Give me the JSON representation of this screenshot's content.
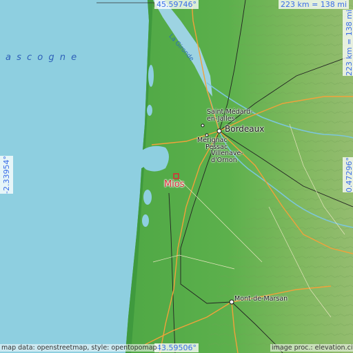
{
  "coords": {
    "top": "45.59746°",
    "bottom": "43.59506°",
    "left": "-2.33954°",
    "right": "0.47296°"
  },
  "scale": {
    "horizontal": "223 km = 138 mi",
    "vertical": "223 km = 138 mi"
  },
  "labels": {
    "sea": "a  s  c  o  g  n  e",
    "river": "La Gironde",
    "bordeaux": "Bordeaux",
    "saint_medard": "Saint-Médard-\nen-Jalles",
    "merignac": "Mérignac",
    "pessac": "Pessac",
    "villenave": "Villenave-\nd'Ornon",
    "mios": "Mios",
    "mont_de_marsan": "Mont-de-Marsan"
  },
  "attribution": {
    "left": "map data: openstreetmap, style: opentopomap",
    "right": "image proc.: elevation.city"
  },
  "colors": {
    "sea": "#8ecfe0",
    "lowland": "#5fb24d",
    "upland": "#86b862",
    "road": "#f3a13a",
    "marker": "#d8303a"
  }
}
